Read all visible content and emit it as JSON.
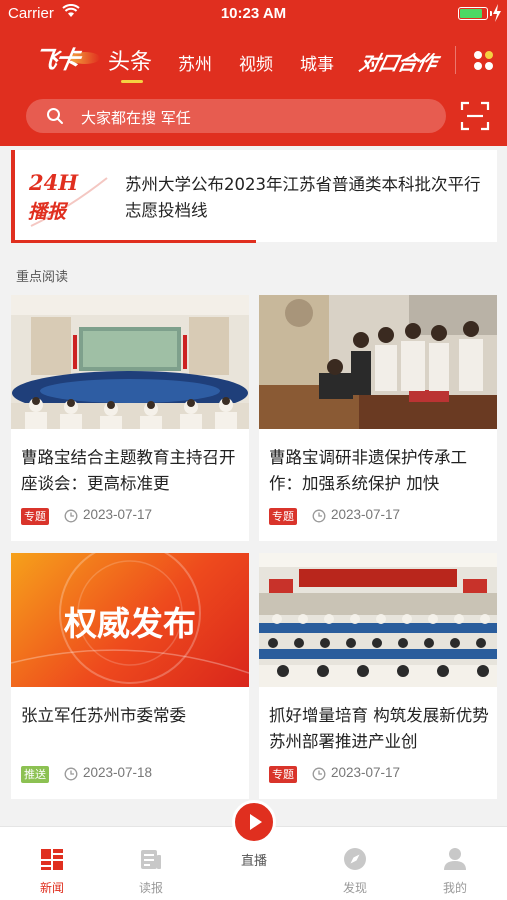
{
  "status_bar": {
    "carrier": "Carrier",
    "time": "10:23 AM"
  },
  "header": {
    "logo_text": "飞卡",
    "tabs": [
      {
        "label": "头条",
        "active": true
      },
      {
        "label": "苏州",
        "active": false
      },
      {
        "label": "视频",
        "active": false
      },
      {
        "label": "城事",
        "active": false
      }
    ],
    "partner_label": "对口合作",
    "search_placeholder": "大家都在搜 军任",
    "accent_color": "#e02f1f"
  },
  "ticker": {
    "badge_top": "24H",
    "badge_bottom": "播报",
    "headline": "苏州大学公布2023年江苏省普通类本科批次平行志愿投档线"
  },
  "section_title": "重点阅读",
  "cards": [
    {
      "title": "曹路宝结合主题教育主持召开座谈会：更高标准更",
      "tag": "专题",
      "tag_color": "#d9342b",
      "date": "2023-07-17"
    },
    {
      "title": "曹路宝调研非遗保护传承工作：加强系统保护 加快",
      "tag": "专题",
      "tag_color": "#d9342b",
      "date": "2023-07-17"
    },
    {
      "title": "张立军任苏州市委常委",
      "tag": "推送",
      "tag_color": "#8cc152",
      "date": "2023-07-18",
      "image_text": "权威发布"
    },
    {
      "title": "抓好增量培育 构筑发展新优势 苏州部署推进产业创",
      "tag": "专题",
      "tag_color": "#d9342b",
      "date": "2023-07-17"
    }
  ],
  "tabbar": {
    "items": [
      {
        "label": "新闻",
        "icon": "news-icon",
        "active": true
      },
      {
        "label": "读报",
        "icon": "newspaper-icon",
        "active": false
      },
      {
        "label": "直播",
        "icon": "play-icon",
        "active": false
      },
      {
        "label": "发现",
        "icon": "compass-icon",
        "active": false
      },
      {
        "label": "我的",
        "icon": "user-icon",
        "active": false
      }
    ]
  }
}
